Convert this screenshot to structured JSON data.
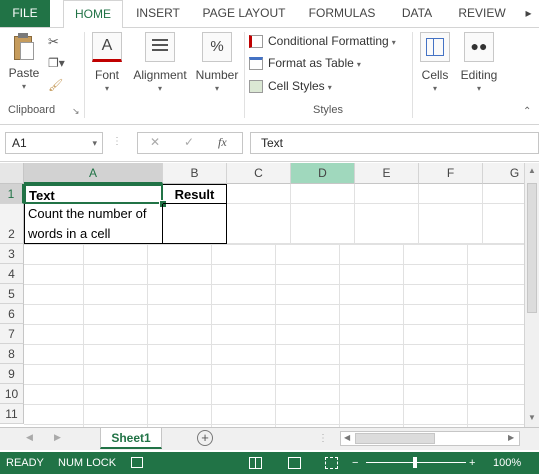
{
  "ribbon_tabs": {
    "file": "FILE",
    "home": "HOME",
    "insert": "INSERT",
    "page_layout": "PAGE LAYOUT",
    "formulas": "FORMULAS",
    "data": "DATA",
    "review": "REVIEW"
  },
  "ribbon": {
    "paste_label": "Paste",
    "clipboard_label": "Clipboard",
    "font_label": "Font",
    "alignment_label": "Alignment",
    "number_label": "Number",
    "conditional_formatting": "Conditional Formatting",
    "format_as_table": "Format as Table",
    "cell_styles": "Cell Styles",
    "styles_label": "Styles",
    "cells_label": "Cells",
    "editing_label": "Editing",
    "font_icon_glyph": "A",
    "number_icon_glyph": "%"
  },
  "formula_bar": {
    "name_box": "A1",
    "cancel_glyph": "✕",
    "enter_glyph": "✓",
    "fx_glyph": "fx",
    "content": "Text"
  },
  "columns": [
    "A",
    "B",
    "C",
    "D",
    "E",
    "F",
    "G"
  ],
  "rows": [
    "1",
    "2",
    "3",
    "4",
    "5",
    "6",
    "7",
    "8",
    "9",
    "10",
    "11"
  ],
  "cells": {
    "A1": "Text",
    "B1": "Result",
    "A2_line1": "Count the number of",
    "A2_line2": "words in a cell"
  },
  "sheets": {
    "active": "Sheet1",
    "add_glyph": "+"
  },
  "status_bar": {
    "ready": "READY",
    "num_lock": "NUM LOCK",
    "zoom": "100%"
  },
  "colors": {
    "accent": "#217346",
    "highlight_column": "#a0d8bd"
  }
}
